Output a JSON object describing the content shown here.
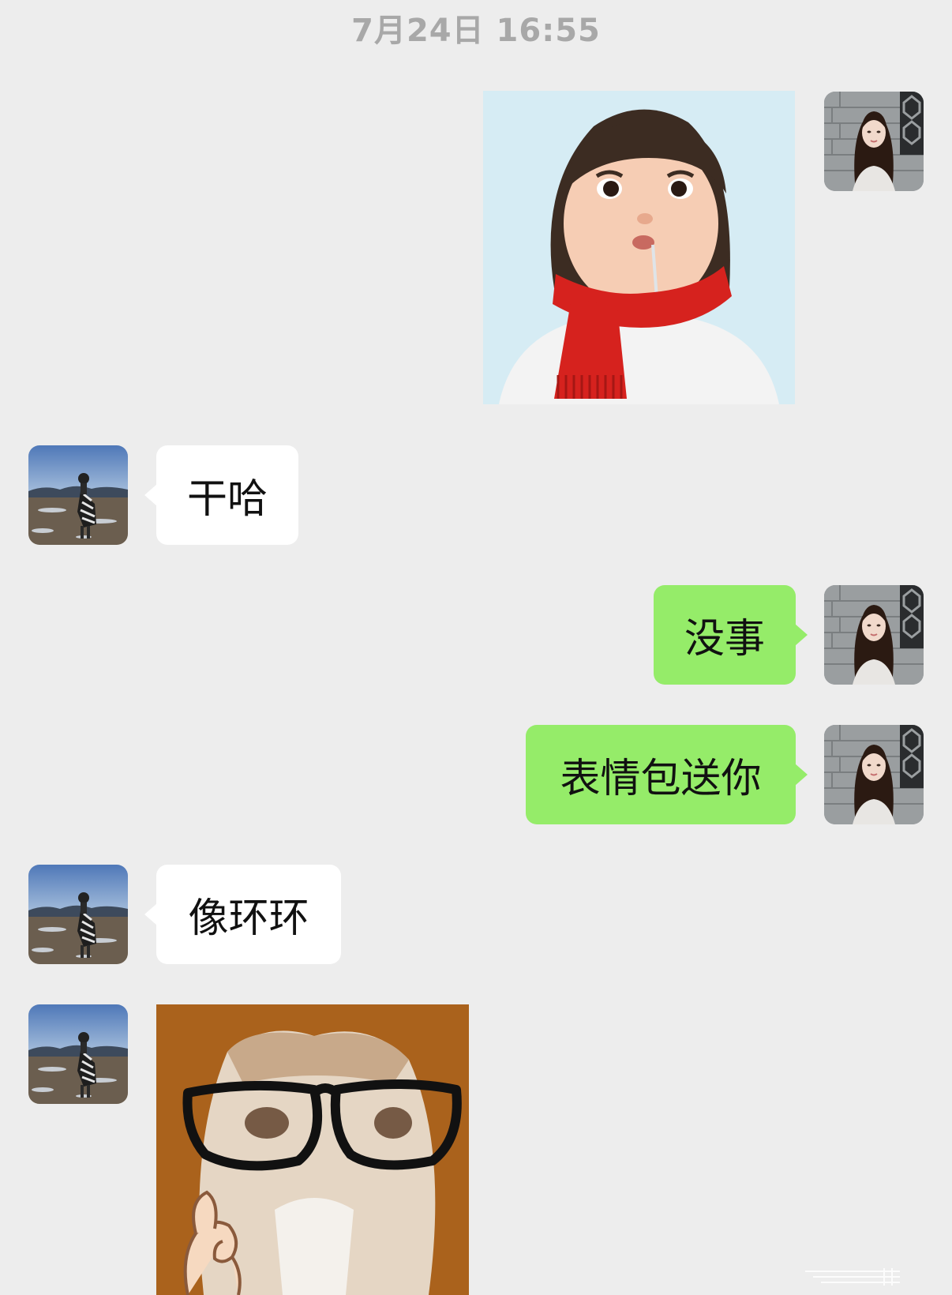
{
  "chat": {
    "timestamp": "7月24日 16:55",
    "messages": [
      {
        "side": "sent",
        "kind": "sticker",
        "sticker": "cartoon-girl-red-scarf-sticker"
      },
      {
        "side": "received",
        "kind": "text",
        "text": "干哈"
      },
      {
        "side": "sent",
        "kind": "text",
        "text": "没事"
      },
      {
        "side": "sent",
        "kind": "text",
        "text": "表情包送你"
      },
      {
        "side": "received",
        "kind": "text",
        "text": "像环环"
      },
      {
        "side": "received",
        "kind": "sticker",
        "sticker": "glasses-cat-ok-hand-sticker"
      }
    ]
  },
  "avatars": {
    "self": "long-hair-girl-avatar",
    "contact": "plateau-landscape-avatar"
  },
  "colors": {
    "background": "#ededed",
    "sent_bubble": "#95ec69",
    "received_bubble": "#ffffff",
    "timestamp_text": "#a8a8a8"
  }
}
